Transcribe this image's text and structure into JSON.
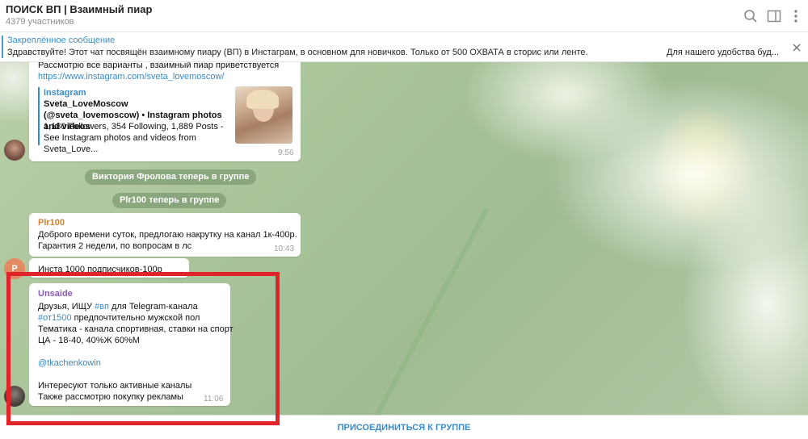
{
  "header": {
    "title": "ПОИСК ВП | Взаимный пиар",
    "subtitle": "4379 участников",
    "icons": [
      "search-icon",
      "sidebar-icon",
      "more-icon"
    ]
  },
  "pinned": {
    "title": "Закреплённое сообщение",
    "text": "Здравствуйте! Этот чат посвящён взаимному пиару (ВП) в Инстаграм, в основном для новичков. Только от 500 ОХВАТА в сторис или ленте.",
    "right_text": "Для нашего удобства буд..."
  },
  "messages": {
    "m1": {
      "text_top": "Рассмотрю все варианты , взаимный пиар приветствуется",
      "link": "https://www.instagram.com/sveta_lovemoscow/",
      "preview_site": "Instagram",
      "preview_title": "Sveta_LoveMoscow (@sveta_lovemoscow) • Instagram photos and videos",
      "preview_desc": "1,180 Followers, 354 Following, 1,889 Posts - See Instagram photos and videos from Sveta_Love...",
      "time": "9:56"
    },
    "service1": "Виктория Фролова теперь в группе",
    "service2": "Plr100 теперь в группе",
    "m2": {
      "sender": "Plr100",
      "line1": "Доброго времени суток, предлогаю накрутку на канал 1к-400р.",
      "line2": "Гарантия 2 недели, по вопросам в лс",
      "time": "10:43"
    },
    "m3": {
      "avatar_letter": "P",
      "text": "Инста 1000 подписчиков-100р"
    },
    "m4": {
      "sender": "Unsaide",
      "l1a": "Друзья, ИЩУ ",
      "l1tag": "#вп",
      "l1b": " для Telegram-канала",
      "l2tag": "#от1500",
      "l2b": " предпочтительно мужской пол",
      "l3": "Тематика - канала спортивная, ставки на спорт",
      "l4": "ЦА - 18-40, 40%Ж 60%М",
      "mention": "@tkachenkowin",
      "l6": "Интересуют только активные каналы",
      "l7": "Также рассмотрю покупку рекламы",
      "time": "11:06"
    }
  },
  "footer": {
    "join_label": "ПРИСОЕДИНИТЬСЯ К ГРУППЕ"
  },
  "colors": {
    "accent": "#3a8bc7",
    "highlight_box": "#e0242a",
    "sender_plr": "#c9833a",
    "sender_unsaide": "#8b5ab5"
  }
}
